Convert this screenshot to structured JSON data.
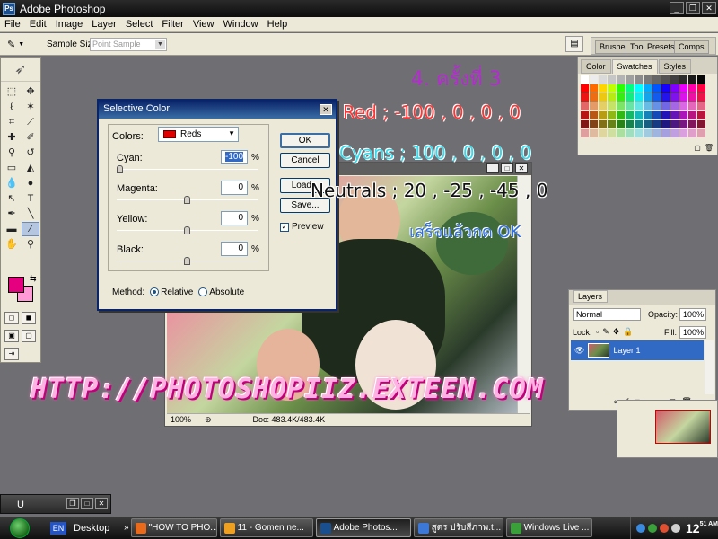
{
  "app": {
    "title": "Adobe Photoshop",
    "menu": [
      "File",
      "Edit",
      "Image",
      "Layer",
      "Select",
      "Filter",
      "View",
      "Window",
      "Help"
    ]
  },
  "options_bar": {
    "sample_size_label": "Sample Size:",
    "sample_size_value": "Point Sample",
    "palette_well_tabs": [
      "Brushes",
      "Tool Presets",
      "Comps"
    ]
  },
  "toolbox": {
    "foreground_color": "#e4007f",
    "background_color": "#ff9ad7",
    "tools": [
      "marquee-icon",
      "move-icon",
      "lasso-icon",
      "magic-wand-icon",
      "crop-icon",
      "slice-icon",
      "healing-brush-icon",
      "brush-icon",
      "clone-stamp-icon",
      "history-brush-icon",
      "eraser-icon",
      "paint-bucket-icon",
      "blur-icon",
      "dodge-icon",
      "path-selection-icon",
      "type-icon",
      "pen-icon",
      "line-icon",
      "notes-icon",
      "eyedropper-icon",
      "hand-icon",
      "zoom-icon"
    ]
  },
  "document": {
    "zoom": "100%",
    "doc_size": "Doc: 483.4K/483.4K"
  },
  "dialog": {
    "title": "Selective Color",
    "colors_label": "Colors:",
    "colors_value": "Reds",
    "colors_swatch": "#e00000",
    "sliders": [
      {
        "label": "Cyan:",
        "value": "-100",
        "fraction": 0.0
      },
      {
        "label": "Magenta:",
        "value": "0",
        "fraction": 0.5
      },
      {
        "label": "Yellow:",
        "value": "0",
        "fraction": 0.5
      },
      {
        "label": "Black:",
        "value": "0",
        "fraction": 0.5
      }
    ],
    "percent_sign": "%",
    "buttons": {
      "ok": "OK",
      "cancel": "Cancel",
      "load": "Load...",
      "save": "Save..."
    },
    "preview_label": "Preview",
    "preview_checked": true,
    "method_label": "Method:",
    "method_options": [
      "Relative",
      "Absolute"
    ],
    "method_selected": "Relative"
  },
  "swatches_panel": {
    "tabs": [
      "Color",
      "Swatches",
      "Styles"
    ],
    "active_tab": "Swatches"
  },
  "layers_panel": {
    "tab": "Layers",
    "blend_mode": "Normal",
    "opacity_label": "Opacity:",
    "opacity_value": "100%",
    "lock_label": "Lock:",
    "fill_label": "Fill:",
    "fill_value": "100%",
    "layer_name": "Layer 1"
  },
  "minimized_window": {
    "label": "U"
  },
  "annotations": {
    "title": "4. ครั้งที่ 3",
    "red_line": "Red ; -100 , 0 , 0 , 0",
    "cyan_line": "Cyans ; 100 , 0 , 0 , 0",
    "neutral_line": "Neutrals ; 20 , -25 , -45 , 0",
    "done_line": "เสร็จแล้วกด OK",
    "watermark": "HTTP://PHOTOSHOPIIZ.EXTEEN.COM"
  },
  "taskbar": {
    "lang": "EN",
    "desktop_label": "Desktop",
    "buttons": [
      {
        "label": "\"HOW TO PHO...",
        "icon_color": "#e86a1a",
        "active": false
      },
      {
        "label": "11 - Gomen ne...",
        "icon_color": "#f0a020",
        "active": false
      },
      {
        "label": "Adobe Photos...",
        "icon_color": "#1a4f8f",
        "active": true
      },
      {
        "label": "สูตร ปรับสีภาพ.t...",
        "icon_color": "#3c78d8",
        "active": false
      },
      {
        "label": "Windows Live ...",
        "icon_color": "#3aa03a",
        "active": false
      }
    ],
    "clock_hour": "12",
    "clock_min": "51",
    "clock_ampm": "AM"
  }
}
